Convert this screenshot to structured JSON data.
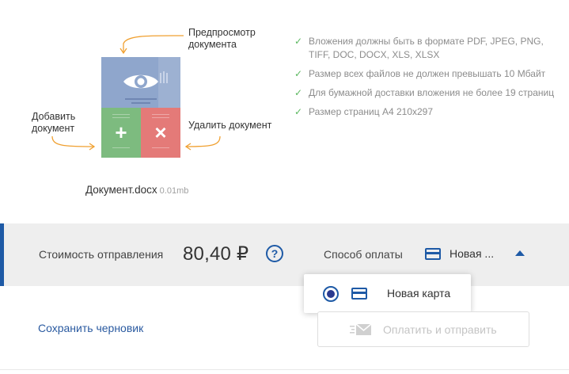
{
  "attachment": {
    "callouts": {
      "preview": "Предпросмотр\nдокумента",
      "add": "Добавить\nдокумент",
      "delete": "Удалить документ"
    },
    "tile_icons": {
      "preview": "eye-icon",
      "add": "+",
      "delete": "×"
    },
    "file_name": "Документ.docx",
    "file_size": "0.01mb"
  },
  "requirements": [
    "Вложения должны быть в формате PDF, JPEG, PNG, TIFF, DOC, DOCX, XLS, XLSX",
    "Размер всех файлов не должен превышать 10 Мбайт",
    "Для бумажной доставки вложения не более 19 страниц",
    "Размер страниц А4 210x297"
  ],
  "cost_bar": {
    "cost_label": "Стоимость отправления",
    "cost_value": "80,40 ₽",
    "help_symbol": "?",
    "pay_method_label": "Способ оплаты",
    "pay_method_value": "Новая ..."
  },
  "dropdown": {
    "options": [
      {
        "label": "Новая карта",
        "selected": true
      }
    ]
  },
  "actions": {
    "save_draft": "Сохранить черновик",
    "pay_and_send": "Оплатить и отправить"
  },
  "colors": {
    "accent": "#1e5aa6",
    "preview_tile": "#8fa6cc",
    "add_tile": "#7dbb7f",
    "delete_tile": "#e47a78",
    "check": "#5cb860",
    "callout_arrow": "#f0a030"
  }
}
